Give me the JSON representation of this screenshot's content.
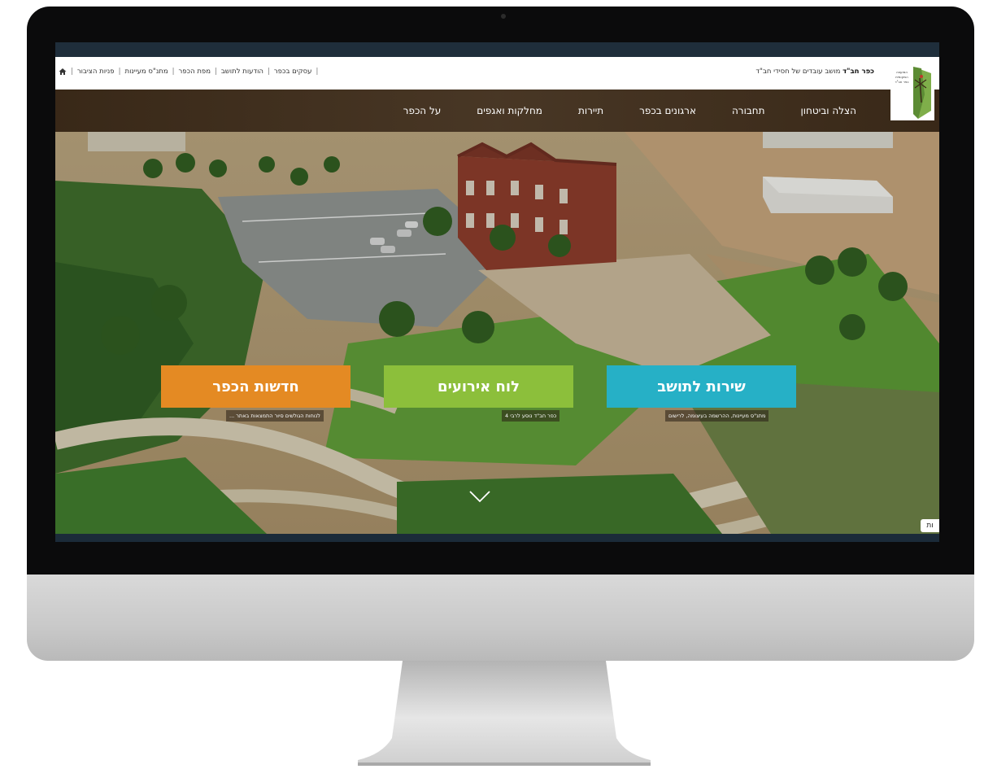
{
  "topbar": {
    "tagline_name": "כפר חב\"ד",
    "tagline_text": "מושב עובדים של חסידי חב\"ד",
    "links": [
      "עסקים בכפר",
      "הודעות לתושב",
      "מפת הכפר",
      "מתנ\"ס מעיינות",
      "פניות הציבור"
    ],
    "logo_text": "המועצה המקומית כפר חב\"ד"
  },
  "nav": {
    "items": [
      "על הכפר",
      "מחלקות ואגפים",
      "תיירות",
      "ארגונים בכפר",
      "תחבורה",
      "הצלה וביטחון"
    ]
  },
  "cta": [
    {
      "title": "שירות לתושב",
      "subtitle": "מתנ\"ס מעיינות, ההרשמה בעיצומה, לרישום",
      "color": "#26b0c6"
    },
    {
      "title": "לוח אירועים",
      "subtitle": "כפר חב\"ד נוסע לרבי 4",
      "color": "#8cbf3b"
    },
    {
      "title": "חדשות הכפר",
      "subtitle": "לנוחות הגולשים סיור התמצאות באתר ...",
      "color": "#e48a23"
    }
  ],
  "side_tab": "ות",
  "colors": {
    "navbar": "#3a2816",
    "screen_frame": "#0b0b0c"
  },
  "icons": {
    "home": "home-icon",
    "scroll": "chevron-down-icon"
  }
}
